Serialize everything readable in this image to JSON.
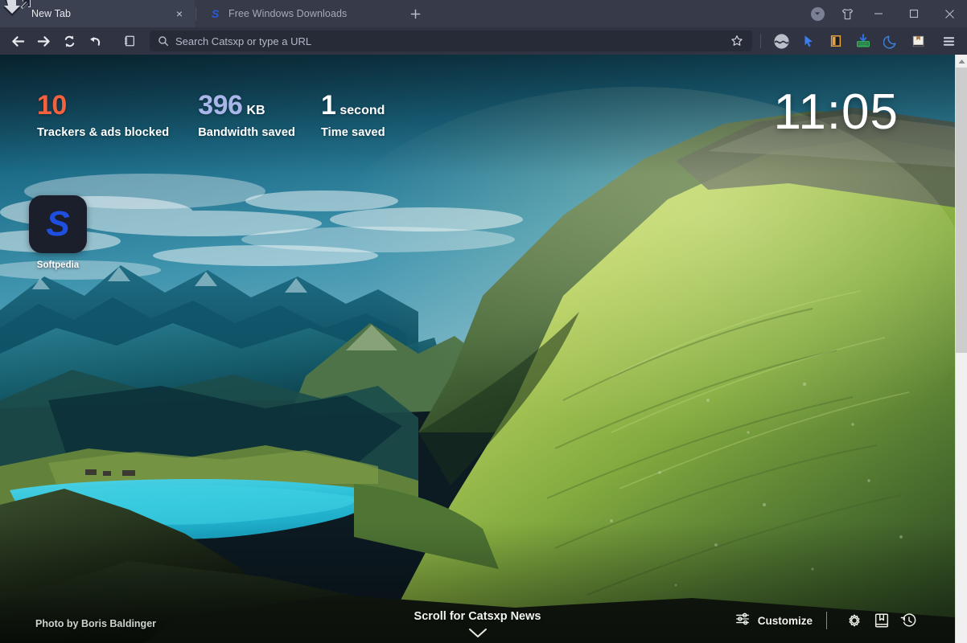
{
  "window": {
    "capture_icon": "screenshot-capture-icon",
    "profile_icon": "profile-avatar-icon",
    "theme_icon": "theme-tshirt-icon",
    "minimize_label": "–",
    "maximize_label": "□",
    "close_label": "×"
  },
  "tabs": [
    {
      "title": "New Tab",
      "favicon": "none",
      "active": true,
      "close_label": "×"
    },
    {
      "title": "Free Windows Downloads",
      "favicon": "softpedia-s-icon",
      "active": false,
      "close_label": "×"
    }
  ],
  "newtab_button": {
    "label": "+",
    "icon": "plus-icon"
  },
  "toolbar": {
    "back_icon": "back-arrow-icon",
    "forward_icon": "forward-arrow-icon",
    "reload_icon": "reload-icon",
    "home_icon": "home-arrow-icon",
    "sidepanel_icon": "side-panel-icon",
    "search_icon": "search-icon",
    "bookmark_icon": "star-icon",
    "menu_icon": "hamburger-menu-icon",
    "extensions": [
      {
        "name": "adblock-icon",
        "title": "Ad blocker"
      },
      {
        "name": "cursor-icon",
        "title": "Cursor"
      },
      {
        "name": "reader-icon",
        "title": "Reader"
      },
      {
        "name": "download-icon",
        "title": "Downloads"
      },
      {
        "name": "dark-mode-moon-icon",
        "title": "Dark mode"
      },
      {
        "name": "package-icon",
        "title": "Package"
      }
    ]
  },
  "omnibox": {
    "placeholder": "Search Catsxp or type a URL",
    "value": ""
  },
  "newtab": {
    "clock": "11:05",
    "stats": [
      {
        "value": "10",
        "unit": "",
        "label": "Trackers & ads blocked",
        "color": "#f4613f"
      },
      {
        "value": "396",
        "unit": "KB",
        "label": "Bandwidth saved",
        "color": "#a9b6ea"
      },
      {
        "value": "1",
        "unit": "second",
        "label": "Time saved",
        "color": "#ffffff"
      }
    ],
    "shortcuts": [
      {
        "label": "Softpedia",
        "letter": "S",
        "tile_color": "#1b1f2b",
        "letter_color": "#1f4fe0"
      }
    ],
    "photo_credit": "Photo by Boris Baldinger",
    "scroll_news": "Scroll for Catsxp News",
    "scroll_chevron_icon": "chevron-down-icon",
    "customize_label": "Customize",
    "customize_icon": "sliders-icon",
    "bottom_icons": [
      {
        "name": "settings-gear-icon"
      },
      {
        "name": "bookmarks-icon"
      },
      {
        "name": "history-clock-icon"
      }
    ]
  },
  "scrollbar": {
    "up_arrow_icon": "scroll-up-arrow-icon"
  }
}
